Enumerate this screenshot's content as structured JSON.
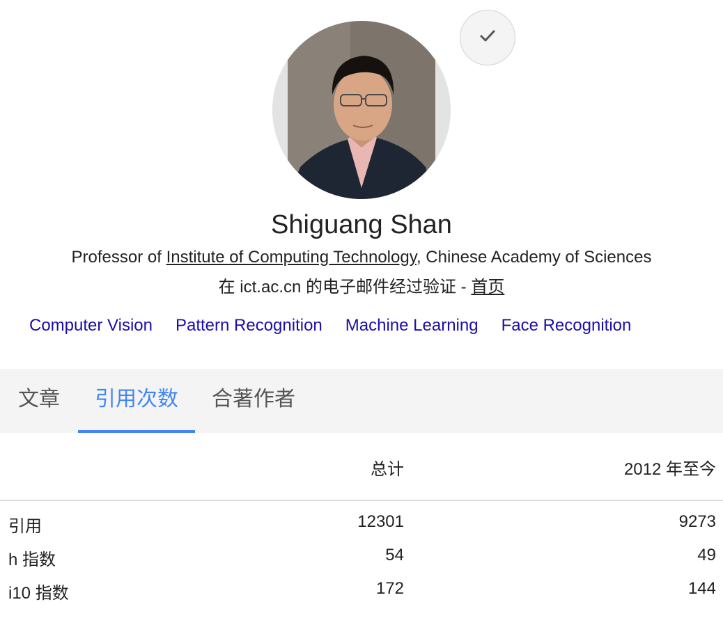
{
  "profile": {
    "name": "Shiguang Shan",
    "affiliation_prefix": "Professor of ",
    "affiliation_link": "Institute of Computing Technology",
    "affiliation_suffix": ", Chinese Academy of Sciences",
    "email_text": "在 ict.ac.cn 的电子邮件经过验证 - ",
    "homepage_link": "首页",
    "verified_icon": "check-icon"
  },
  "interests": [
    "Computer Vision",
    "Pattern Recognition",
    "Machine Learning",
    "Face Recognition"
  ],
  "tabs": [
    {
      "label": "文章",
      "active": false
    },
    {
      "label": "引用次数",
      "active": true
    },
    {
      "label": "合著作者",
      "active": false
    }
  ],
  "stats": {
    "headers": {
      "total": "总计",
      "since": "2012 年至今"
    },
    "rows": [
      {
        "label": "引用",
        "total": "12301",
        "since": "9273"
      },
      {
        "label": "h 指数",
        "total": "54",
        "since": "49"
      },
      {
        "label": "i10 指数",
        "total": "172",
        "since": "144"
      }
    ]
  },
  "colors": {
    "link": "#1a0dab",
    "accent": "#4285f4",
    "tab_bg": "#f4f4f4"
  }
}
